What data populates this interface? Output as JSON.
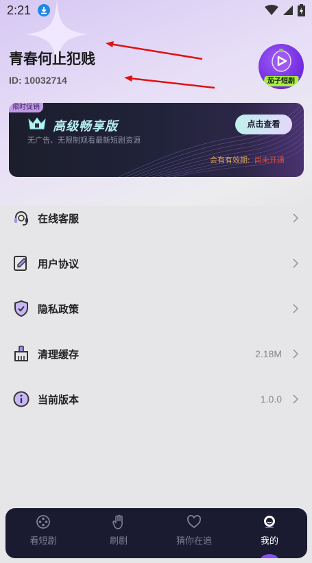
{
  "status_bar": {
    "time": "2:21"
  },
  "profile": {
    "name": "青春何止犯贱",
    "id_text": "ID:  10032714"
  },
  "logo": {
    "text": "茄子短剧"
  },
  "promo": {
    "tag": "限时促销",
    "title": "高级畅享版",
    "description": "无广告、无限制观看最新短剧资源",
    "button": "点击查看",
    "expire_label": "会有有效期:",
    "expire_value": "尚未开通"
  },
  "menu": {
    "items": [
      {
        "label": "在线客服",
        "icon": "headset-icon",
        "value": ""
      },
      {
        "label": "用户协议",
        "icon": "edit-document-icon",
        "value": ""
      },
      {
        "label": "隐私政策",
        "icon": "shield-check-icon",
        "value": ""
      },
      {
        "label": "清理缓存",
        "icon": "broom-icon",
        "value": "2.18M"
      },
      {
        "label": "当前版本",
        "icon": "info-icon",
        "value": "1.0.0"
      }
    ]
  },
  "tabbar": {
    "tabs": [
      {
        "label": "看短剧",
        "icon": "film-reel-icon"
      },
      {
        "label": "刷剧",
        "icon": "swipe-hand-icon"
      },
      {
        "label": "猜你在追",
        "icon": "heart-icon"
      },
      {
        "label": "我的",
        "icon": "profile-icon",
        "active": true
      }
    ]
  },
  "colors": {
    "accent": "#8a4df0",
    "tabbar_bg": "#1a1a30",
    "promo_title": "#b6ecf0",
    "expire_value": "#e24a3a",
    "annotation_arrow": "#e01010"
  }
}
